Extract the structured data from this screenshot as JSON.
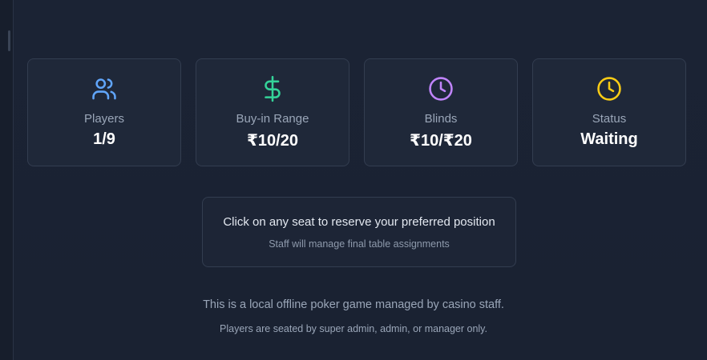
{
  "stats": [
    {
      "icon": "users-icon",
      "label": "Players",
      "value": "1/9",
      "color": "#60a5fa"
    },
    {
      "icon": "dollar-icon",
      "label": "Buy-in Range",
      "value": "₹10/20",
      "color": "#34d399"
    },
    {
      "icon": "clock-icon",
      "label": "Blinds",
      "value": "₹10/₹20",
      "color": "#c084fc"
    },
    {
      "icon": "clock-icon",
      "label": "Status",
      "value": "Waiting",
      "color": "#facc15"
    }
  ],
  "notice": {
    "main": "Click on any seat to reserve your preferred position",
    "sub": "Staff will manage final table assignments"
  },
  "footer": {
    "line1": "This is a local offline poker game managed by casino staff.",
    "line2": "Players are seated by super admin, admin, or manager only."
  }
}
